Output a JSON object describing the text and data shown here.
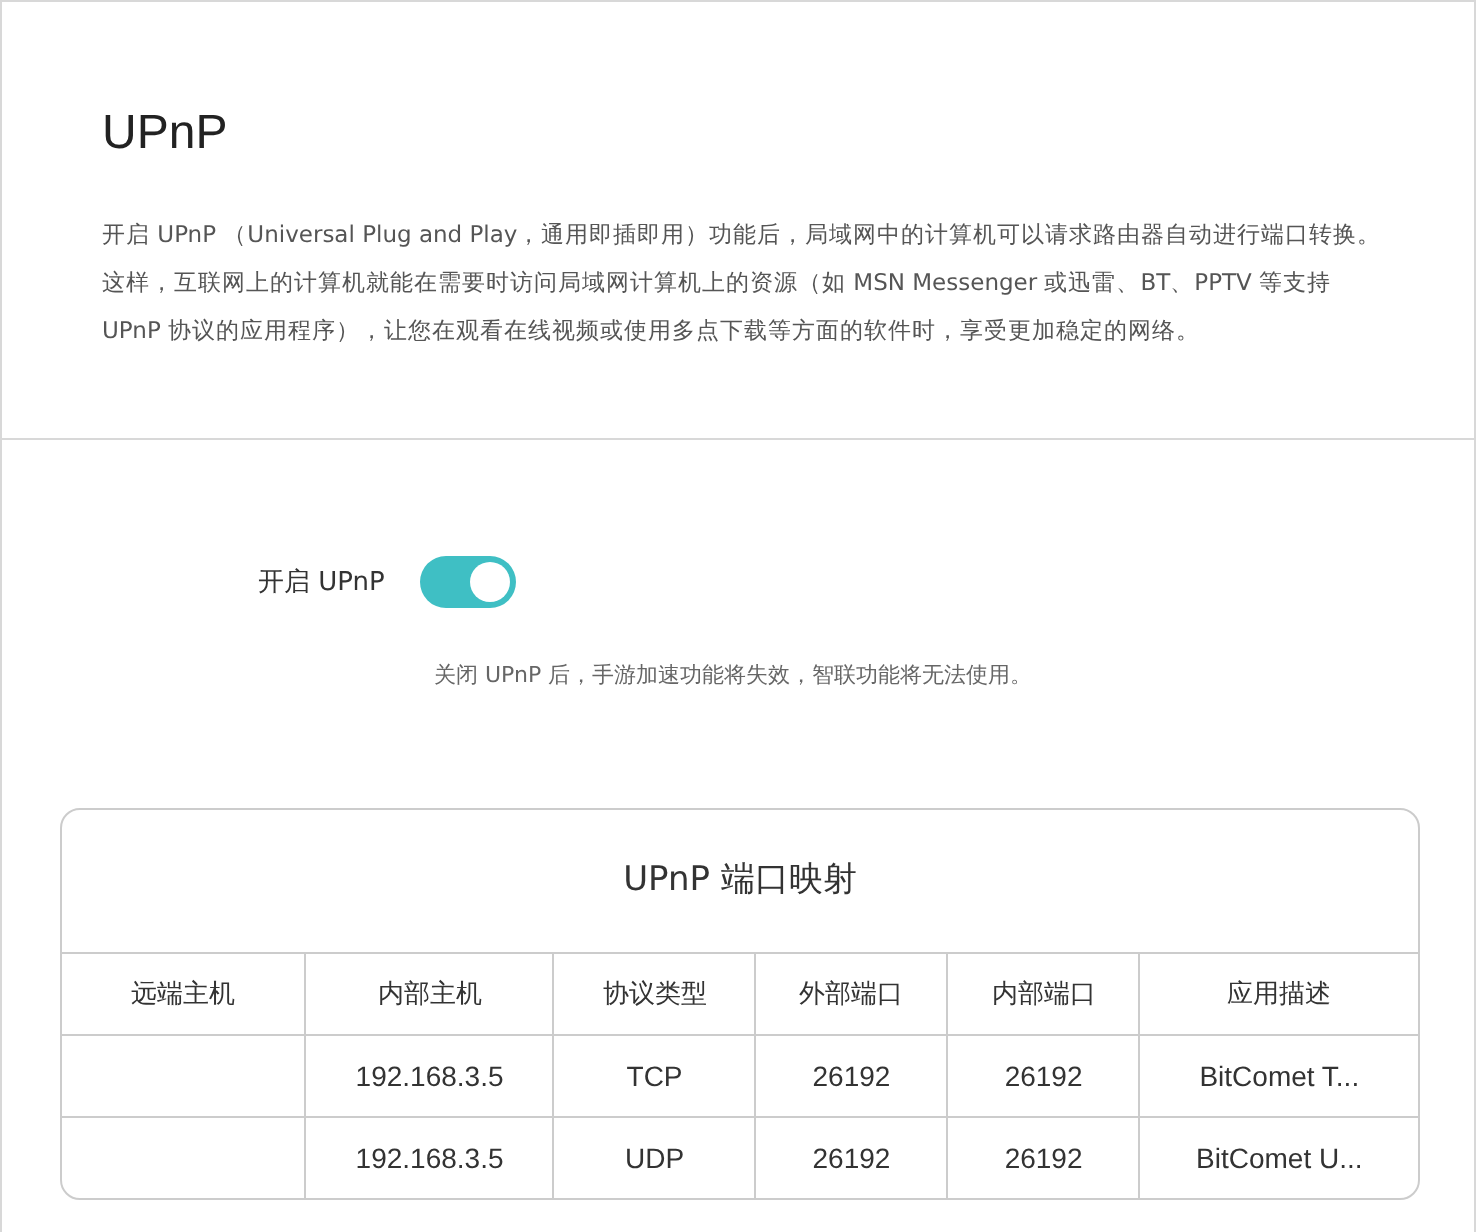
{
  "title": "UPnP",
  "description": "开启 UPnP （Universal Plug and Play，通用即插即用）功能后，局域网中的计算机可以请求路由器自动进行端口转换。这样，互联网上的计算机就能在需要时访问局域网计算机上的资源（如 MSN Messenger 或迅雷、BT、PPTV 等支持 UPnP 协议的应用程序），让您在观看在线视频或使用多点下载等方面的软件时，享受更加稳定的网络。",
  "toggle": {
    "label": "开启 UPnP",
    "on": true
  },
  "hint": "关闭 UPnP 后，手游加速功能将失效，智联功能将无法使用。",
  "table": {
    "title": "UPnP 端口映射",
    "columns": [
      "远端主机",
      "内部主机",
      "协议类型",
      "外部端口",
      "内部端口",
      "应用描述"
    ],
    "rows": [
      [
        "",
        "192.168.3.5",
        "TCP",
        "26192",
        "26192",
        "BitComet T..."
      ],
      [
        "",
        "192.168.3.5",
        "UDP",
        "26192",
        "26192",
        "BitComet U..."
      ]
    ]
  }
}
